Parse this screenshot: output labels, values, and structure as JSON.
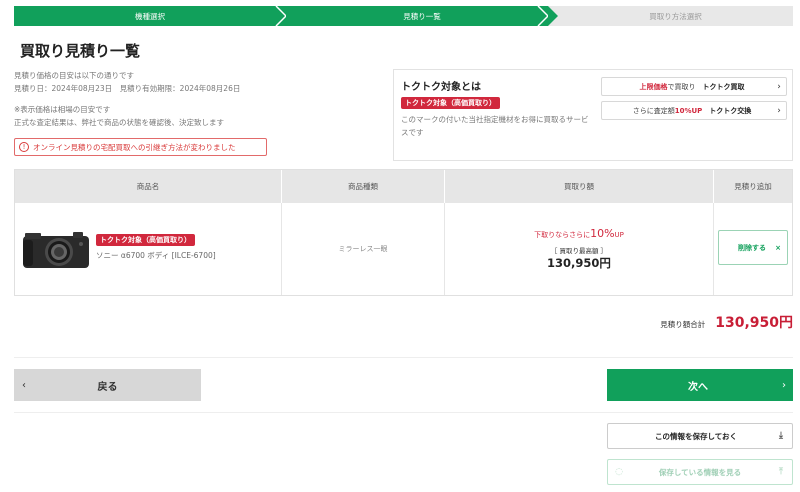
{
  "steps": [
    "機種選択",
    "見積り一覧",
    "買取り方法選択"
  ],
  "page_title": "買取り見積り一覧",
  "notes": {
    "line1": "見積り価格の目安は以下の通りです",
    "line2": "見積り日：2024年08月23日　見積り有効期限：2024年08月26日",
    "line3": "※表示価格は相場の目安です",
    "line4": "正式な査定結果は、弊社で商品の状態を確認後、決定致します"
  },
  "alert_text": "オンライン見積りの宅配買取への引継ぎ方法が変わりました",
  "info": {
    "title": "トクトク対象とは",
    "badge": "トクトク対象（高価買取り）",
    "desc": "このマークの付いた当社指定機材をお得に買取るサービスです",
    "link1": {
      "red": "上限価格",
      "mid": "で買取り",
      "bold": "トクトク買取"
    },
    "link2": {
      "pre": "さらに査定額",
      "red": "10%UP",
      "bold": "トクトク交換"
    }
  },
  "table": {
    "headers": [
      "商品名",
      "商品種類",
      "買取り額",
      "見積り追加"
    ],
    "rows": [
      {
        "badge": "トクトク対象（高価買取り）",
        "name": "ソニー α6700 ボディ [ILCE-6700]",
        "type": "ミラーレス一眼",
        "promo_pre": "下取りならさらに",
        "promo_pct": "10%",
        "promo_post": "UP",
        "price_note": "［ 買取り最高額 ］",
        "price": "130,950円",
        "delete_label": "削除する"
      }
    ]
  },
  "total": {
    "label": "見積り額合計",
    "amount": "130,950円"
  },
  "buttons": {
    "back": "戻る",
    "next": "次へ",
    "save": "この情報を保存しておく",
    "load": "保存している情報を見る"
  },
  "colors": {
    "green": "#11a05b",
    "red": "#d1283d"
  }
}
